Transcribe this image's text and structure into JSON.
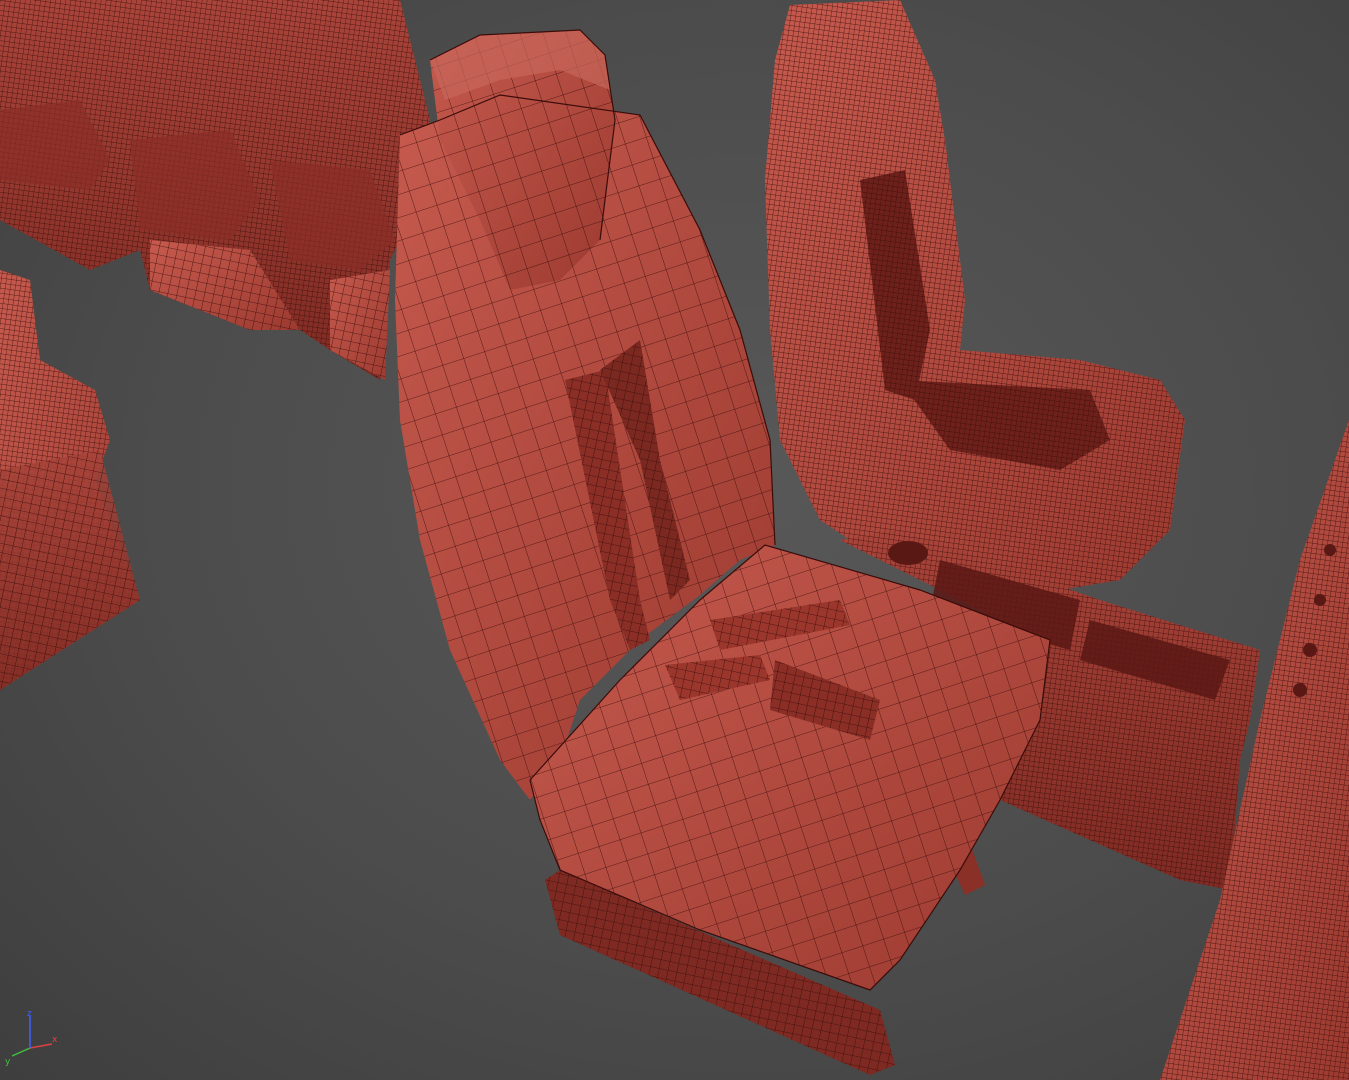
{
  "viewport": {
    "background": "#4c4c4c",
    "mesh_color": "#b84a40",
    "wire_color": "#3a0c0a"
  },
  "axis_gizmo": {
    "x_label": "x",
    "y_label": "y",
    "z_label": "z",
    "x_color": "#e04040",
    "y_color": "#40c040",
    "z_color": "#4060ff"
  }
}
